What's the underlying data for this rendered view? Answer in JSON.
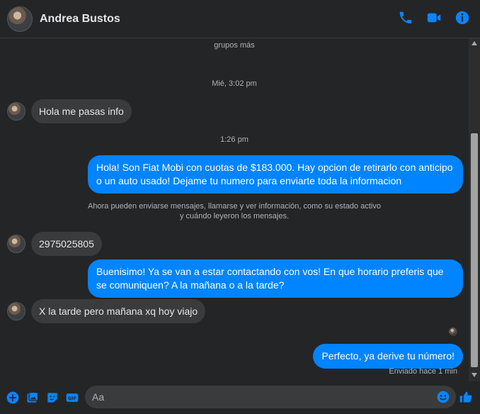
{
  "header": {
    "name": "Andrea Bustos"
  },
  "colors": {
    "accent": "#0084ff",
    "background": "#242526",
    "incoming_bubble": "#3a3b3c",
    "outgoing_bubble": "#0084ff"
  },
  "chat": {
    "top_partial": "grupos más",
    "ts1": "Mié, 3:02 pm",
    "msg1": "Hola me pasas info",
    "ts2": "1:26 pm",
    "out1": "Hola! Son Fiat Mobi con cuotas de $183.000. Hay opcion de retirarlo con anticipo o un auto usado! Dejame tu numero para enviarte toda la informacion",
    "notice_line1": "Ahora pueden enviarse mensajes, llamarse y ver información, como su estado activo",
    "notice_line2": "y cuándo leyeron los mensajes.",
    "msg2": "2975025805",
    "out2": "Buenisimo! Ya se van a estar contactando con vos! En que horario preferis que se comuniquen? A la mañana o a la tarde?",
    "msg3": "X la tarde pero mañana xq hoy viajo",
    "out3": "Perfecto, ya derive tu número!",
    "status": "Enviado hace 1 min"
  },
  "composer": {
    "placeholder": "Aa"
  },
  "icons": [
    "phone-icon",
    "video-call-icon",
    "info-icon",
    "plus-icon",
    "image-icon",
    "sticker-icon",
    "gif-icon",
    "emoji-icon",
    "like-icon"
  ]
}
